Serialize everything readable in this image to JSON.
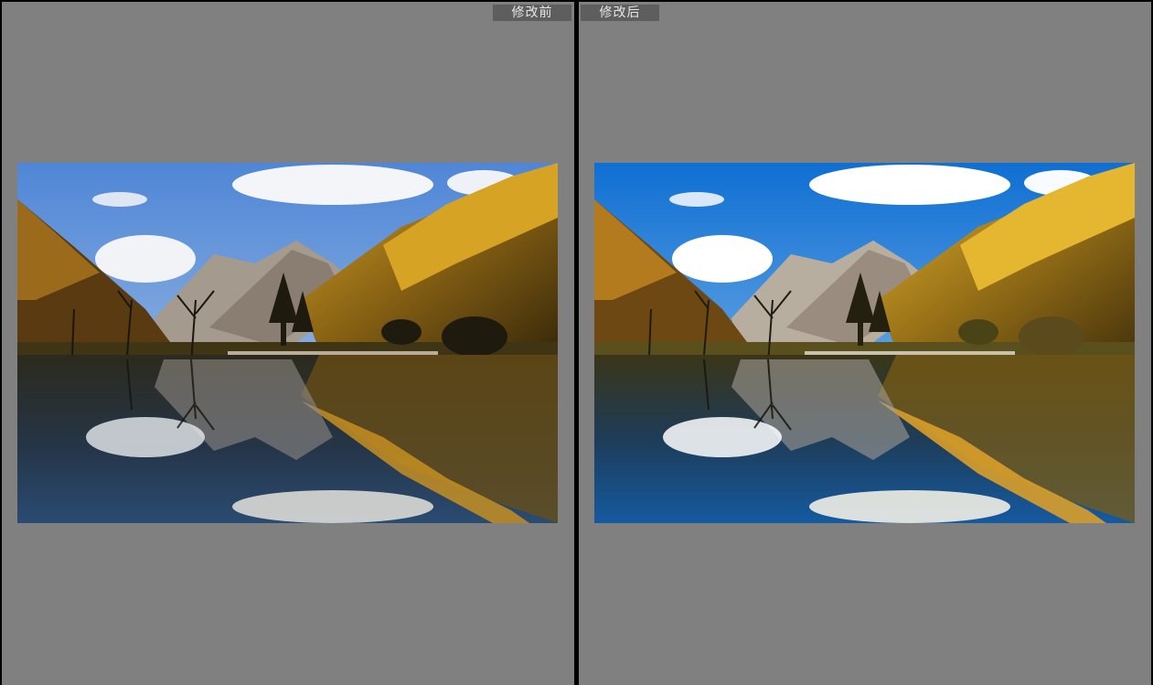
{
  "compare_view": {
    "before_label": "修改前",
    "after_label": "修改后"
  },
  "photos": {
    "before": {
      "icon": "landscape-photo-before"
    },
    "after": {
      "icon": "landscape-photo-after"
    }
  }
}
